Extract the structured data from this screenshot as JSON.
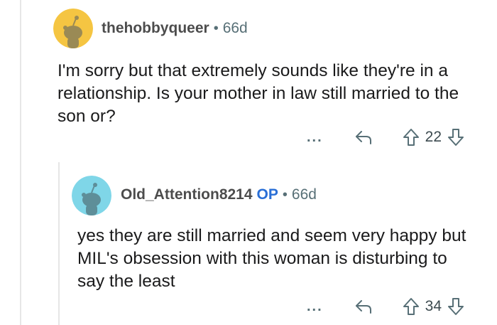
{
  "comments": [
    {
      "username": "thehobbyqueer",
      "age": "66d",
      "separator": "•",
      "body": "I'm sorry but that extremely sounds like they're in a relationship. Is your mother in law still married to the son or?",
      "more": "...",
      "score": "22",
      "avatar_color": "#f5c542"
    },
    {
      "username": "Old_Attention8214",
      "op_badge": "OP",
      "age": "66d",
      "separator": "•",
      "body": "yes they are still married and seem very happy but MIL's obsession with this woman is disturbing to say the least",
      "more": "...",
      "score": "34",
      "avatar_color": "#7fd6e8"
    }
  ],
  "colors": {
    "op_badge": "#2a6fd6",
    "meta_text": "#576f76",
    "thread_line": "#e6e6e6"
  }
}
